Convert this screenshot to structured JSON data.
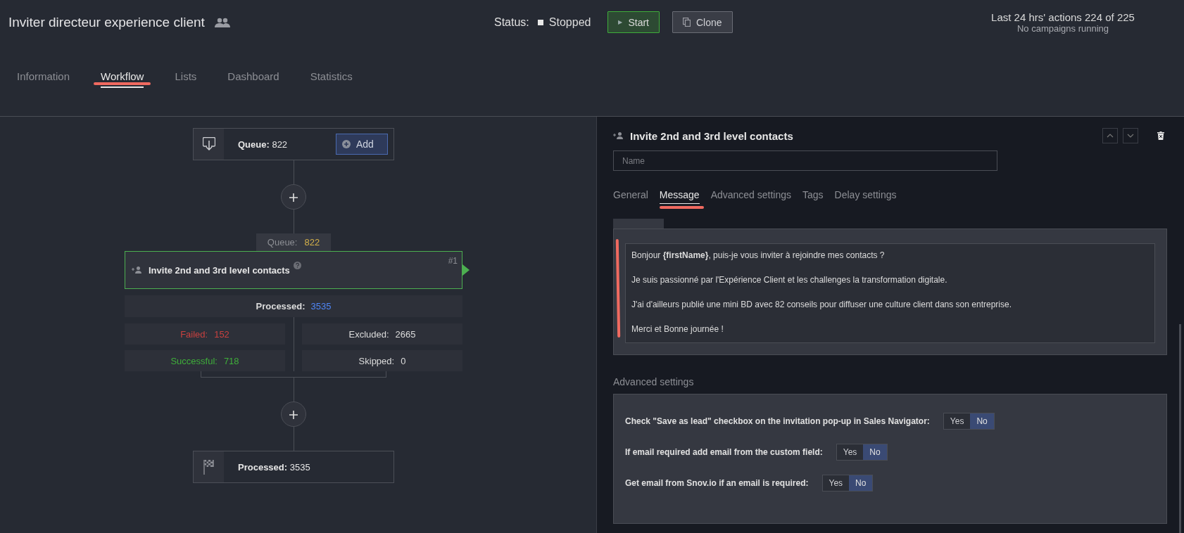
{
  "header": {
    "title": "Inviter directeur experience client",
    "status_label": "Status:",
    "status_value": "Stopped",
    "running": false,
    "buttons": [
      {
        "kind": "start",
        "label": "Start",
        "icon": "▶"
      },
      {
        "kind": "clone",
        "label": "Clone"
      }
    ],
    "actions": "Last 24 hrs' actions 224 of 225",
    "campaigns": "No campaigns running"
  },
  "tabs": [
    {
      "label": "Information",
      "selected": false
    },
    {
      "label": "Workflow",
      "selected": true
    },
    {
      "label": "Lists",
      "selected": false
    },
    {
      "label": "Dashboard",
      "selected": false
    },
    {
      "label": "Statistics",
      "selected": false
    }
  ],
  "workflow": {
    "start_node": {
      "label": "Queue:",
      "value": "822",
      "button": "Add"
    },
    "step": {
      "queue_label": "Queue:",
      "queue_value": "822",
      "title": "Invite 2nd and 3rd level contacts",
      "number": "#1",
      "selected": true,
      "processed": {
        "label": "Processed:",
        "value": "3535"
      },
      "stats": [
        {
          "label": "Failed:",
          "value": "152",
          "color": "#c9413f"
        },
        {
          "label": "Excluded:",
          "value": "2665",
          "color": "#dcdcdc"
        },
        {
          "label": "Successful:",
          "value": "718",
          "color": "#3fae3a"
        },
        {
          "label": "Skipped:",
          "value": "0",
          "color": "#dcdcdc"
        }
      ]
    },
    "end_node": {
      "label": "Processed:",
      "value": "3535"
    }
  },
  "details": {
    "title": "Invite 2nd and 3rd level contacts",
    "name_placeholder": "Name",
    "tabs": [
      {
        "label": "General",
        "selected": false
      },
      {
        "label": "Message",
        "selected": true
      },
      {
        "label": "Advanced settings",
        "selected": false
      },
      {
        "label": "Tags",
        "selected": false
      },
      {
        "label": "Delay settings",
        "selected": false
      }
    ],
    "message": [
      "Bonjour **{firstName}**, puis-je vous inviter à rejoindre mes contacts ?",
      "Je suis passionné par l'Expérience Client et les challenges la transformation digitale.",
      "J'ai d'ailleurs publié une mini BD avec 82 conseils pour diffuser une culture client dans son entreprise.",
      "Merci et Bonne journée !"
    ],
    "advanced_title": "Advanced settings",
    "settings": [
      {
        "label": "Check \"Save as lead\" checkbox on the invitation pop-up in Sales Navigator:",
        "options": [
          {
            "label": "Yes",
            "selected": false
          },
          {
            "label": "No",
            "selected": true
          }
        ]
      },
      {
        "label": "If email required add email from the custom field:",
        "options": [
          {
            "label": "Yes",
            "selected": false
          },
          {
            "label": "No",
            "selected": true
          }
        ]
      },
      {
        "label": "Get email from Snov.io if an email is required:",
        "options": [
          {
            "label": "Yes",
            "selected": false
          },
          {
            "label": "No",
            "selected": true
          }
        ]
      }
    ]
  }
}
